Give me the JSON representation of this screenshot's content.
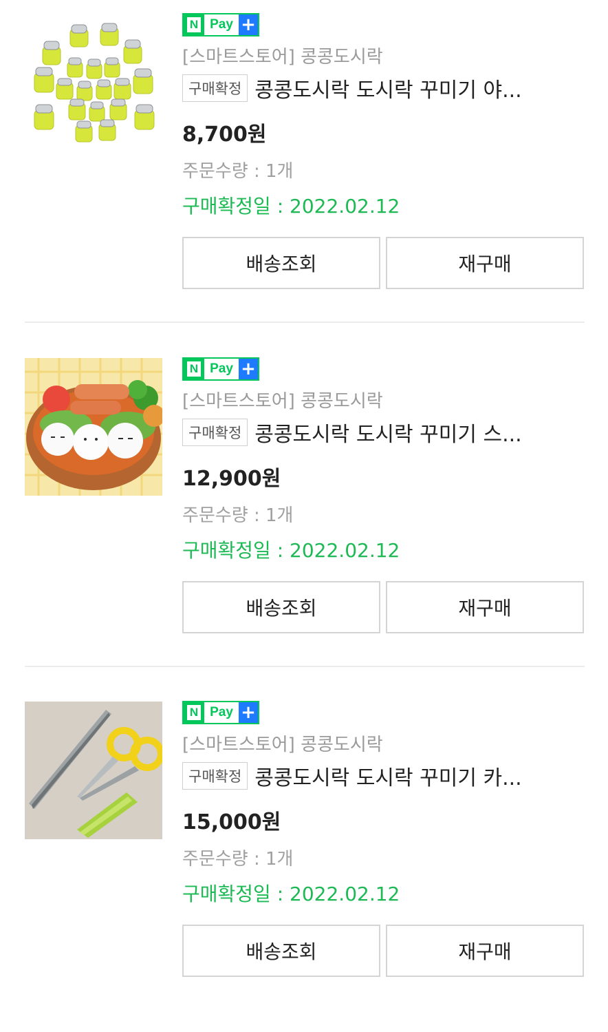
{
  "colors": {
    "npay_green": "#03c75a",
    "npay_plus_blue": "#1e7bff",
    "confirm_green": "#1db954",
    "muted_gray": "#9a9a9a"
  },
  "orders": [
    {
      "image_icon": "vegetable-cutter-set-photo",
      "npay": {
        "n": "N",
        "pay": "Pay",
        "plus": "+"
      },
      "store": "[스마트스토어] 콩콩도시락",
      "status_tag": "구매확정",
      "title": "콩콩도시락 도시락 꾸미기 야...",
      "price": "8,700원",
      "qty_label": "주문수량",
      "qty_value": "1개",
      "confirm_label": "구매확정일",
      "confirm_date": "2022.02.12",
      "btn_track": "배송조회",
      "btn_reorder": "재구매"
    },
    {
      "image_icon": "bento-box-photo",
      "npay": {
        "n": "N",
        "pay": "Pay",
        "plus": "+"
      },
      "store": "[스마트스토어] 콩콩도시락",
      "status_tag": "구매확정",
      "title": "콩콩도시락 도시락 꾸미기 스...",
      "price": "12,900원",
      "qty_label": "주문수량",
      "qty_value": "1개",
      "confirm_label": "구매확정일",
      "confirm_date": "2022.02.12",
      "btn_track": "배송조회",
      "btn_reorder": "재구매"
    },
    {
      "image_icon": "tweezers-scissors-photo",
      "npay": {
        "n": "N",
        "pay": "Pay",
        "plus": "+"
      },
      "store": "[스마트스토어] 콩콩도시락",
      "status_tag": "구매확정",
      "title": "콩콩도시락 도시락 꾸미기 카...",
      "price": "15,000원",
      "qty_label": "주문수량",
      "qty_value": "1개",
      "confirm_label": "구매확정일",
      "confirm_date": "2022.02.12",
      "btn_track": "배송조회",
      "btn_reorder": "재구매"
    }
  ]
}
